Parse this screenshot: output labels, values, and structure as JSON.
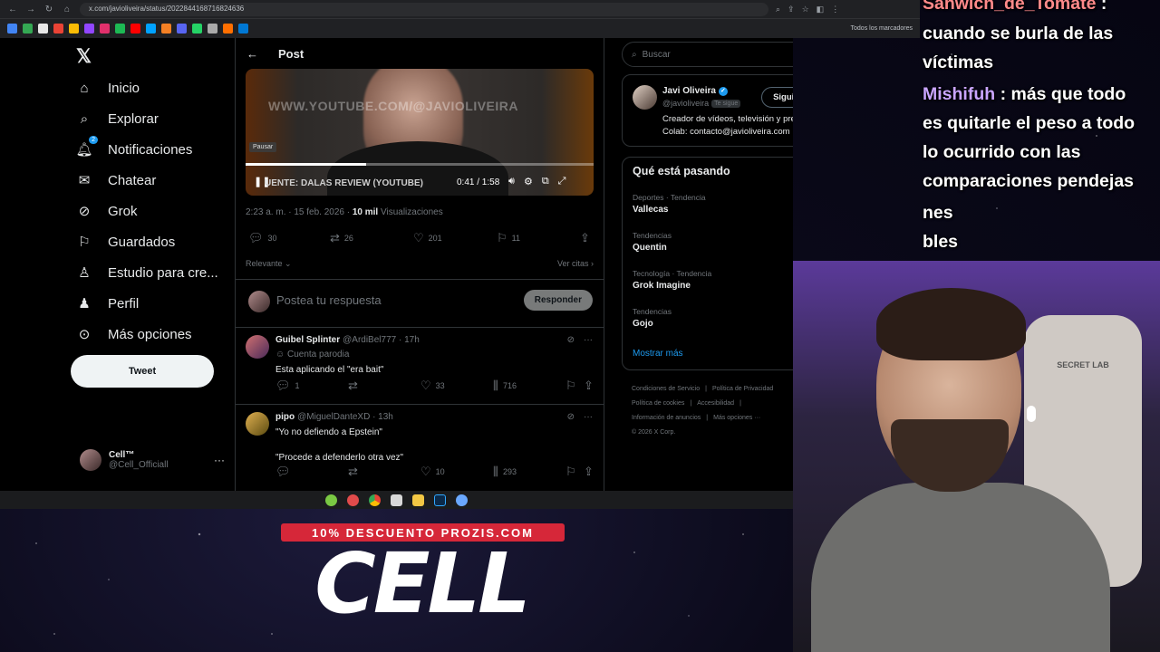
{
  "browser": {
    "url": "x.com/javioliveira/status/2022844168716824636",
    "bookmarks_folder": "Todos los marcadores"
  },
  "sidebar": {
    "items": [
      {
        "label": "Inicio",
        "icon": "home-icon"
      },
      {
        "label": "Explorar",
        "icon": "search-icon"
      },
      {
        "label": "Notificaciones",
        "icon": "bell-icon",
        "badge": "2"
      },
      {
        "label": "Chatear",
        "icon": "mail-icon"
      },
      {
        "label": "Grok",
        "icon": "grok-icon"
      },
      {
        "label": "Guardados",
        "icon": "bookmark-icon"
      },
      {
        "label": "Estudio para cre...",
        "icon": "studio-icon"
      },
      {
        "label": "Perfil",
        "icon": "person-icon"
      },
      {
        "label": "Más opciones",
        "icon": "more-circle-icon"
      }
    ],
    "tweet_button": "Tweet",
    "account": {
      "name": "Cell™",
      "handle": "@Cell_Officiall"
    }
  },
  "post": {
    "header_title": "Post",
    "video": {
      "watermark": "WWW.YOUTUBE.COM/@JAVIOLIVEIRA",
      "source_label": "UENTE: DALAS REVIEW (YOUTUBE)",
      "tooltip": "Pausar",
      "time": "0:41 / 1:58",
      "progress": 0.347
    },
    "meta": {
      "time": "2:23 a. m. · 15 feb. 2026 · ",
      "views_count": "10 mil",
      "views_label": " Visualizaciones"
    },
    "stats": {
      "replies": "30",
      "retweets": "26",
      "likes": "201",
      "bookmarks": "11"
    },
    "filter": {
      "sort": "Relevante",
      "quotes": "Ver citas"
    },
    "reply_box": {
      "placeholder": "Postea tu respuesta",
      "button": "Responder"
    }
  },
  "replies": [
    {
      "name": "Guibel Splinter",
      "handle": "@ArdiBel777 · 17h",
      "subtitle": "Cuenta parodia",
      "text": "Esta aplicando el \"era bait\"",
      "text2": "",
      "stats": {
        "replies": "1",
        "retweets": "",
        "likes": "33",
        "views": "716"
      }
    },
    {
      "name": "pipo",
      "handle": "@MiguelDanteXD · 13h",
      "subtitle": "",
      "text": "\"Yo no defiendo a Epstein\"",
      "text2": "\"Procede a defenderlo otra vez\"",
      "stats": {
        "replies": "",
        "retweets": "",
        "likes": "10",
        "views": "293"
      }
    }
  ],
  "right": {
    "search_placeholder": "Buscar",
    "profile": {
      "name": "Javi Oliveira",
      "handle": "@javioliveira",
      "follows_you": "Te sigue",
      "bio_line1": "Creador de vídeos, televisión y prensa.",
      "bio_line2": "Colab: contacto@javioliveira.com",
      "follow_button": "Siguiendo"
    },
    "trends_title": "Qué está pasando",
    "trends": [
      {
        "category": "Deportes · Tendencia",
        "name": "Vallecas"
      },
      {
        "category": "Tendencias",
        "name": "Quentin"
      },
      {
        "category": "Tecnología · Tendencia",
        "name": "Grok Imagine"
      },
      {
        "category": "Tendencias",
        "name": "Gojo"
      }
    ],
    "show_more": "Mostrar más",
    "footer": {
      "links1": [
        "Condiciones de Servicio",
        "|",
        "Política de Privacidad"
      ],
      "links2": [
        "Política de cookies",
        "|",
        "Accesibilidad",
        "|"
      ],
      "links3": [
        "Información de anuncios",
        "|",
        "Más opciones ···"
      ],
      "copyright": "© 2026 X Corp."
    }
  },
  "chat": [
    {
      "user": "Sanwich_de_Tomate",
      "text": " :"
    },
    {
      "user": "",
      "text": "cuando se burla de las"
    },
    {
      "user": "",
      "text": "víctimas"
    },
    {
      "user": "Mishifuh",
      "text": " : más que todo"
    },
    {
      "user": "",
      "text": "es quitarle el peso a todo"
    },
    {
      "user": "",
      "text": "lo ocurrido con las"
    },
    {
      "user": "",
      "text": "comparaciones pendejas"
    },
    {
      "user": "",
      "text": "nes"
    },
    {
      "user": "",
      "text": "bles"
    }
  ],
  "webcam": {
    "chair_brand": "SECRET LAB"
  },
  "promo": {
    "band": "10% DESCUENTO PROZIS.COM",
    "big": "CELL"
  },
  "colors": {
    "accent": "#1d9bf0",
    "promo_red": "#d62739",
    "chat_user": "#c9a5ff"
  }
}
